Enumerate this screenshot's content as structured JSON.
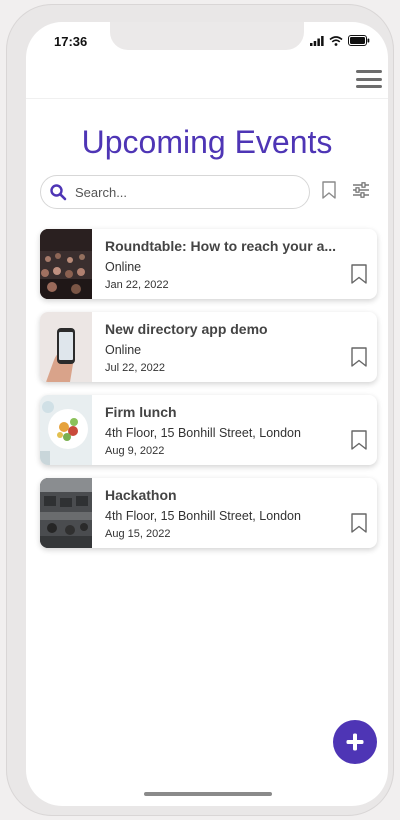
{
  "status_bar": {
    "time": "17:36"
  },
  "page": {
    "title": "Upcoming Events"
  },
  "search": {
    "placeholder": "Search..."
  },
  "events": [
    {
      "title": "Roundtable: How to reach your a...",
      "location": "Online",
      "date": "Jan 22, 2022",
      "thumbnail": "audience-photo"
    },
    {
      "title": "New directory app demo",
      "location": "Online",
      "date": "Jul 22, 2022",
      "thumbnail": "phone-in-hand-photo"
    },
    {
      "title": "Firm lunch",
      "location": "4th Floor, 15 Bonhill Street, London",
      "date": "Aug 9, 2022",
      "thumbnail": "food-plate-photo"
    },
    {
      "title": "Hackathon",
      "location": "4th Floor, 15 Bonhill Street, London",
      "date": "Aug 15, 2022",
      "thumbnail": "office-photo"
    }
  ],
  "colors": {
    "accent": "#4e35b5"
  }
}
